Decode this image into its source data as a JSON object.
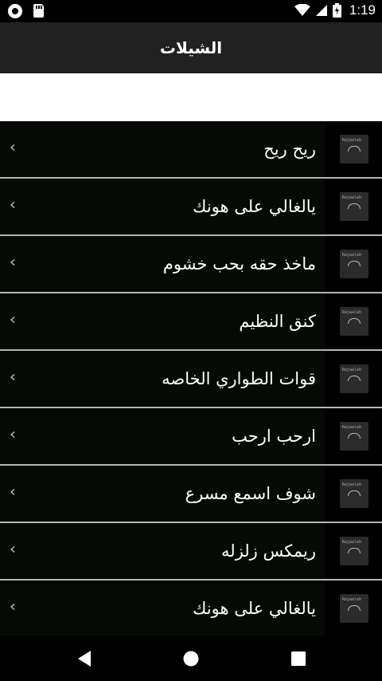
{
  "status_bar": {
    "time": "1:19",
    "left_icons": [
      "record-icon",
      "sd-card-icon"
    ],
    "right_icons": [
      "wifi-icon",
      "cellular-icon",
      "battery-charging-icon"
    ]
  },
  "app_bar": {
    "title": "الشيلات"
  },
  "search": {
    "value": ""
  },
  "items": [
    {
      "title": "ريح ريح",
      "thumb_text": "Rajwalah"
    },
    {
      "title": "يالغالي على هونك",
      "thumb_text": "Rajwalah"
    },
    {
      "title": "ماخذ حقه بحب خشوم",
      "thumb_text": "Rajwalah"
    },
    {
      "title": "كنق النظيم",
      "thumb_text": "Rajwalah"
    },
    {
      "title": "قوات الطواري الخاصه",
      "thumb_text": "Rajwalah"
    },
    {
      "title": "ارحب ارحب",
      "thumb_text": "Rajwalah"
    },
    {
      "title": "شوف اسمع مسرع",
      "thumb_text": "Rajwalah"
    },
    {
      "title": "ريمكس زلزله",
      "thumb_text": "Rajwalah"
    },
    {
      "title": "يالغالي على هونك",
      "thumb_text": "Rajwalah"
    }
  ],
  "nav_bar": {
    "buttons": [
      "back-icon",
      "home-icon",
      "recents-icon"
    ]
  },
  "colors": {
    "status_bar": "#000000",
    "app_bar": "#212121",
    "row_bg": "#050a05",
    "divider": "#b5b5b5"
  }
}
